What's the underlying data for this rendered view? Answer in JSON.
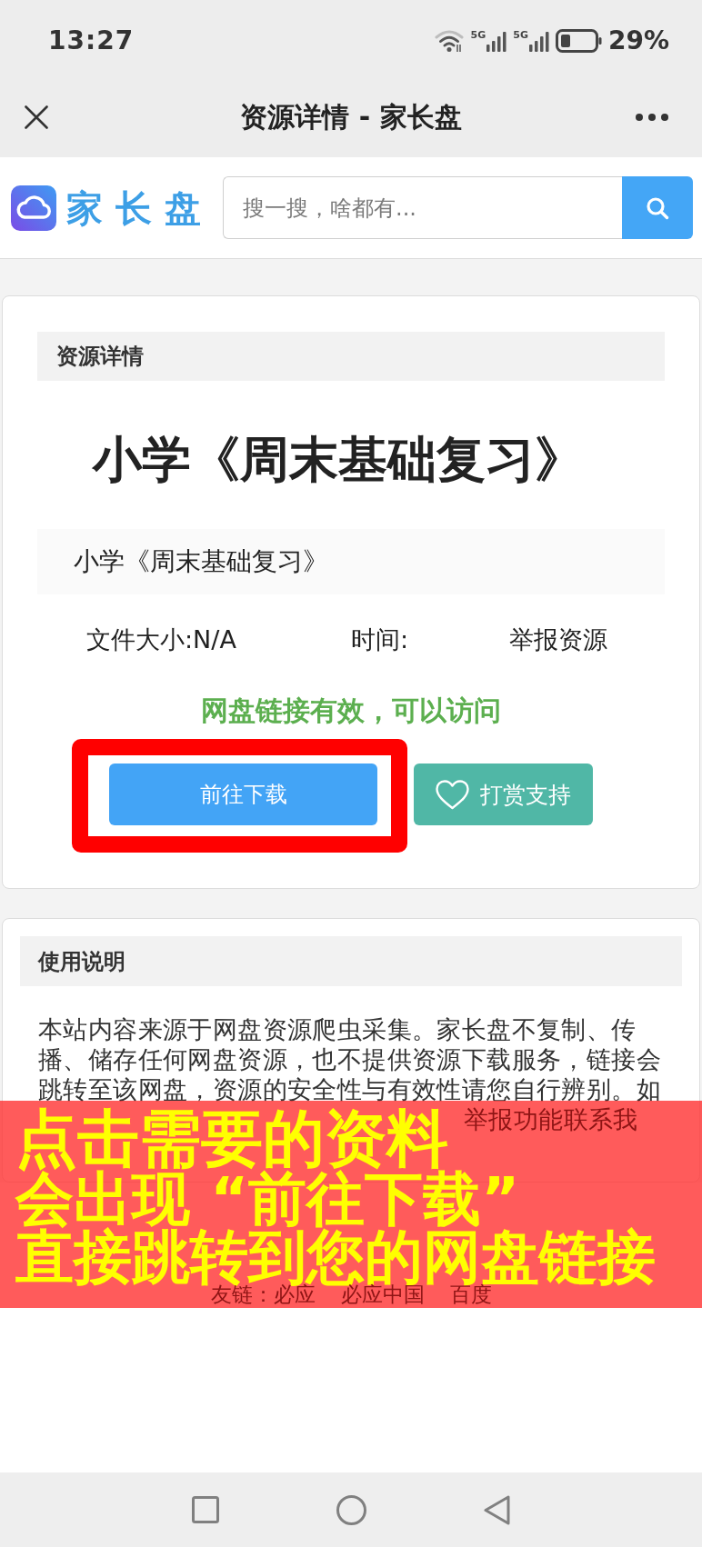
{
  "status_bar": {
    "time": "13:27",
    "networks": [
      "5G",
      "5G"
    ],
    "battery": "29%"
  },
  "title_bar": {
    "title": "资源详情 - 家长盘"
  },
  "header": {
    "brand": "家长盘",
    "search": {
      "placeholder": "搜一搜，啥都有..."
    }
  },
  "detail_card": {
    "heading": "资源详情",
    "title": "小学《周末基础复习》",
    "subtitle": "小学《周末基础复习》",
    "file_size": "文件大小:N/A",
    "time": "时间:",
    "report_link": "举报资源",
    "link_status": "网盘链接有效，可以访问",
    "download_button": {
      "label": "前往下载",
      "highlighted": true
    },
    "reward_button": {
      "label": "打赏支持",
      "highlighted": false
    }
  },
  "usage_card": {
    "heading": "使用说明",
    "paragraph": "本站内容来源于网盘资源爬虫采集。家长盘不复制、传播、储存任何网盘资源，也不提供资源下载服务，链接会跳转至该网盘，资源的安全性与有效性请您自行辨别。如",
    "paragraph_fragment": "举报功能联系我"
  },
  "footer": {
    "label": "友链：",
    "links": [
      "必应",
      "必应中国",
      "百度"
    ]
  },
  "caption_banner": {
    "lines": [
      "点击需要的资料",
      "会出现 “前往下载”",
      "直接跳转到您的网盘链接"
    ]
  }
}
